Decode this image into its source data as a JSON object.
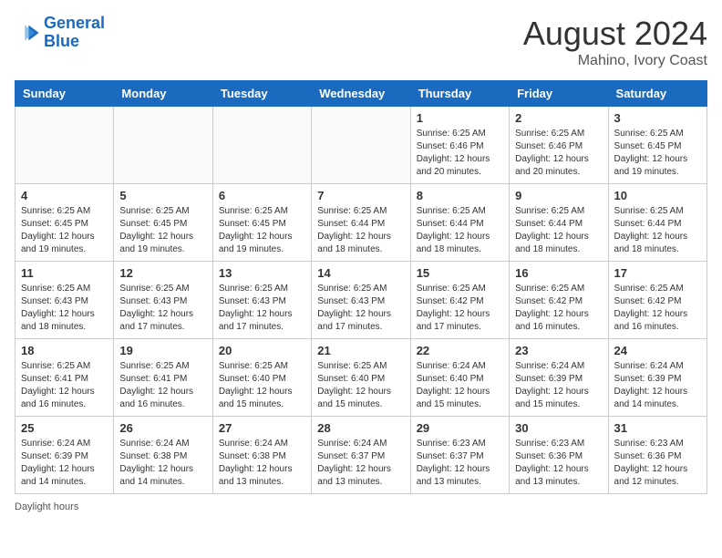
{
  "header": {
    "logo_line1": "General",
    "logo_line2": "Blue",
    "month": "August 2024",
    "location": "Mahino, Ivory Coast"
  },
  "days_of_week": [
    "Sunday",
    "Monday",
    "Tuesday",
    "Wednesday",
    "Thursday",
    "Friday",
    "Saturday"
  ],
  "weeks": [
    [
      {
        "day": "",
        "info": ""
      },
      {
        "day": "",
        "info": ""
      },
      {
        "day": "",
        "info": ""
      },
      {
        "day": "",
        "info": ""
      },
      {
        "day": "1",
        "info": "Sunrise: 6:25 AM\nSunset: 6:46 PM\nDaylight: 12 hours and 20 minutes."
      },
      {
        "day": "2",
        "info": "Sunrise: 6:25 AM\nSunset: 6:46 PM\nDaylight: 12 hours and 20 minutes."
      },
      {
        "day": "3",
        "info": "Sunrise: 6:25 AM\nSunset: 6:45 PM\nDaylight: 12 hours and 19 minutes."
      }
    ],
    [
      {
        "day": "4",
        "info": "Sunrise: 6:25 AM\nSunset: 6:45 PM\nDaylight: 12 hours and 19 minutes."
      },
      {
        "day": "5",
        "info": "Sunrise: 6:25 AM\nSunset: 6:45 PM\nDaylight: 12 hours and 19 minutes."
      },
      {
        "day": "6",
        "info": "Sunrise: 6:25 AM\nSunset: 6:45 PM\nDaylight: 12 hours and 19 minutes."
      },
      {
        "day": "7",
        "info": "Sunrise: 6:25 AM\nSunset: 6:44 PM\nDaylight: 12 hours and 18 minutes."
      },
      {
        "day": "8",
        "info": "Sunrise: 6:25 AM\nSunset: 6:44 PM\nDaylight: 12 hours and 18 minutes."
      },
      {
        "day": "9",
        "info": "Sunrise: 6:25 AM\nSunset: 6:44 PM\nDaylight: 12 hours and 18 minutes."
      },
      {
        "day": "10",
        "info": "Sunrise: 6:25 AM\nSunset: 6:44 PM\nDaylight: 12 hours and 18 minutes."
      }
    ],
    [
      {
        "day": "11",
        "info": "Sunrise: 6:25 AM\nSunset: 6:43 PM\nDaylight: 12 hours and 18 minutes."
      },
      {
        "day": "12",
        "info": "Sunrise: 6:25 AM\nSunset: 6:43 PM\nDaylight: 12 hours and 17 minutes."
      },
      {
        "day": "13",
        "info": "Sunrise: 6:25 AM\nSunset: 6:43 PM\nDaylight: 12 hours and 17 minutes."
      },
      {
        "day": "14",
        "info": "Sunrise: 6:25 AM\nSunset: 6:43 PM\nDaylight: 12 hours and 17 minutes."
      },
      {
        "day": "15",
        "info": "Sunrise: 6:25 AM\nSunset: 6:42 PM\nDaylight: 12 hours and 17 minutes."
      },
      {
        "day": "16",
        "info": "Sunrise: 6:25 AM\nSunset: 6:42 PM\nDaylight: 12 hours and 16 minutes."
      },
      {
        "day": "17",
        "info": "Sunrise: 6:25 AM\nSunset: 6:42 PM\nDaylight: 12 hours and 16 minutes."
      }
    ],
    [
      {
        "day": "18",
        "info": "Sunrise: 6:25 AM\nSunset: 6:41 PM\nDaylight: 12 hours and 16 minutes."
      },
      {
        "day": "19",
        "info": "Sunrise: 6:25 AM\nSunset: 6:41 PM\nDaylight: 12 hours and 16 minutes."
      },
      {
        "day": "20",
        "info": "Sunrise: 6:25 AM\nSunset: 6:40 PM\nDaylight: 12 hours and 15 minutes."
      },
      {
        "day": "21",
        "info": "Sunrise: 6:25 AM\nSunset: 6:40 PM\nDaylight: 12 hours and 15 minutes."
      },
      {
        "day": "22",
        "info": "Sunrise: 6:24 AM\nSunset: 6:40 PM\nDaylight: 12 hours and 15 minutes."
      },
      {
        "day": "23",
        "info": "Sunrise: 6:24 AM\nSunset: 6:39 PM\nDaylight: 12 hours and 15 minutes."
      },
      {
        "day": "24",
        "info": "Sunrise: 6:24 AM\nSunset: 6:39 PM\nDaylight: 12 hours and 14 minutes."
      }
    ],
    [
      {
        "day": "25",
        "info": "Sunrise: 6:24 AM\nSunset: 6:39 PM\nDaylight: 12 hours and 14 minutes."
      },
      {
        "day": "26",
        "info": "Sunrise: 6:24 AM\nSunset: 6:38 PM\nDaylight: 12 hours and 14 minutes."
      },
      {
        "day": "27",
        "info": "Sunrise: 6:24 AM\nSunset: 6:38 PM\nDaylight: 12 hours and 13 minutes."
      },
      {
        "day": "28",
        "info": "Sunrise: 6:24 AM\nSunset: 6:37 PM\nDaylight: 12 hours and 13 minutes."
      },
      {
        "day": "29",
        "info": "Sunrise: 6:23 AM\nSunset: 6:37 PM\nDaylight: 12 hours and 13 minutes."
      },
      {
        "day": "30",
        "info": "Sunrise: 6:23 AM\nSunset: 6:36 PM\nDaylight: 12 hours and 13 minutes."
      },
      {
        "day": "31",
        "info": "Sunrise: 6:23 AM\nSunset: 6:36 PM\nDaylight: 12 hours and 12 minutes."
      }
    ]
  ],
  "footer": {
    "daylight_label": "Daylight hours"
  }
}
